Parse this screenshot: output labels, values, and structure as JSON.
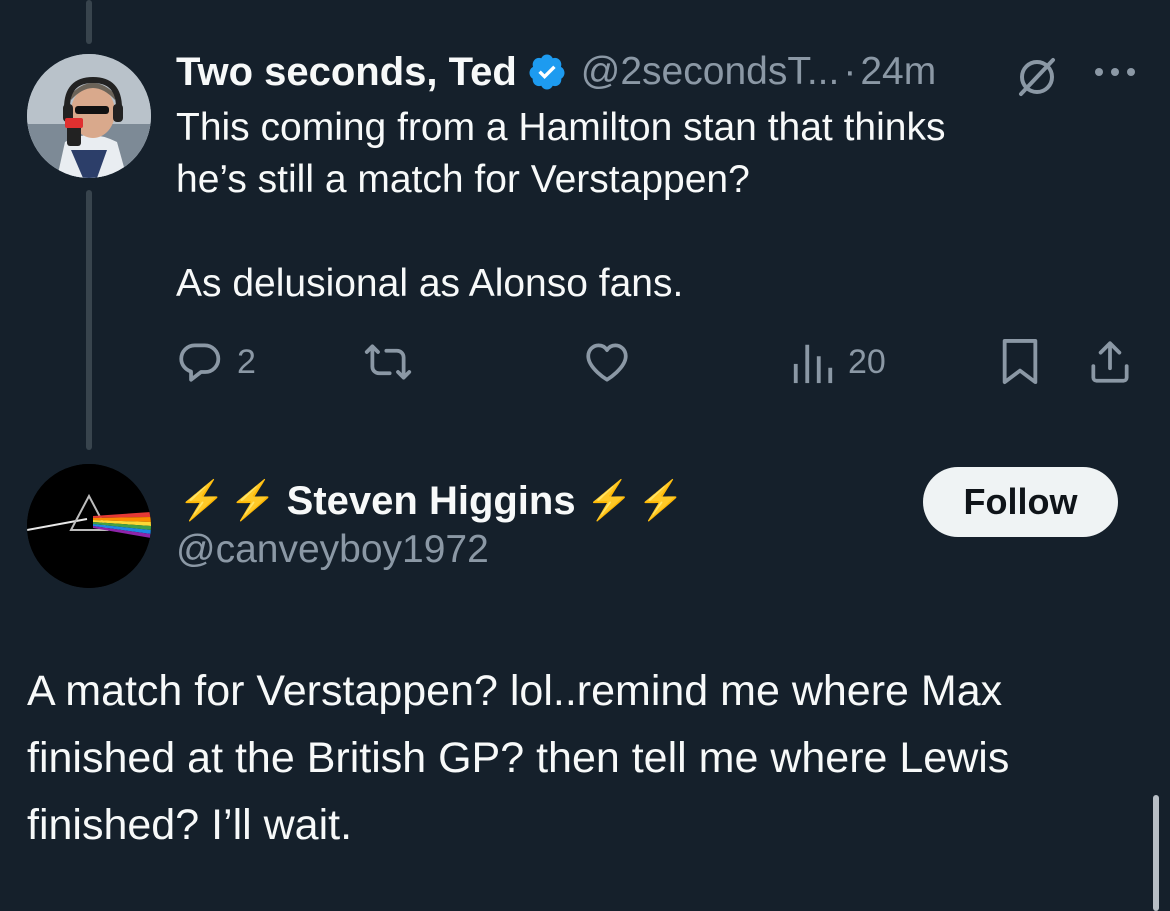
{
  "tweet1": {
    "display_name": "Two seconds, Ted",
    "handle": "@2secondsT...",
    "separator": "·",
    "time": "24m",
    "body": "This coming from a Hamilton stan that thinks\nhe’s still a match for Verstappen?\n\nAs delusional as Alonso fans.",
    "actions": {
      "replies": "2",
      "reposts": "",
      "likes": "",
      "views": "20"
    },
    "icons": [
      "verified-badge-icon",
      "grok-icon",
      "more-icon",
      "reply-icon",
      "repost-icon",
      "like-icon",
      "views-icon",
      "bookmark-icon",
      "share-icon"
    ]
  },
  "tweet2": {
    "display_name": "Steven Higgins",
    "name_emoji": "⚡",
    "handle": "@canveyboy1972",
    "follow_label": "Follow",
    "body": "A match for Verstappen? lol..remind me where Max\nfinished at the British GP? then tell me where Lewis\nfinished? I’ll wait."
  },
  "colors": {
    "background": "#15202b",
    "text": "#f7f9f9",
    "secondary": "#8b98a5",
    "verified": "#1d9bf0",
    "thread_line": "#38444d",
    "follow_bg": "#eff3f4"
  }
}
